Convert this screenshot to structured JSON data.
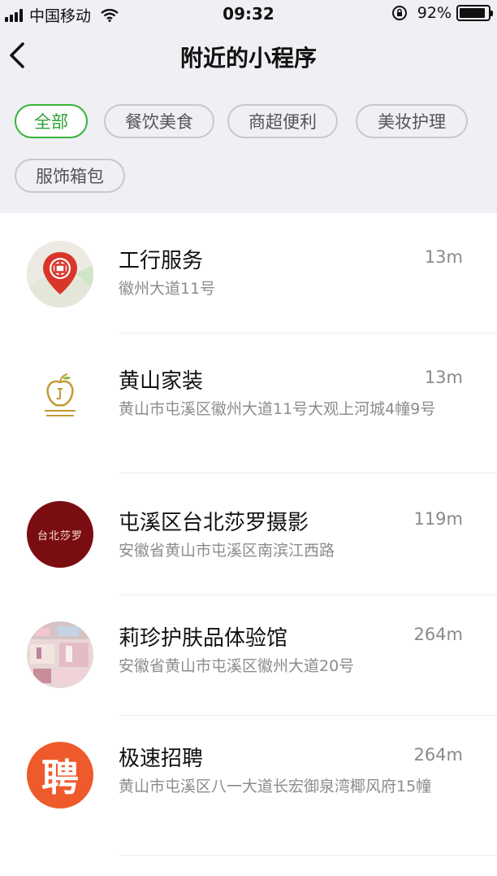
{
  "status_bar": {
    "carrier": "中国移动",
    "time": "09:32",
    "battery": "92%",
    "battery_level": 0.92
  },
  "nav": {
    "title": "附近的小程序",
    "back_icon": "chevron-left-icon"
  },
  "categories": [
    {
      "label": "全部",
      "active": true
    },
    {
      "label": "餐饮美食",
      "active": false
    },
    {
      "label": "商超便利",
      "active": false
    },
    {
      "label": "美妆护理",
      "active": false
    },
    {
      "label": "服饰箱包",
      "active": false
    }
  ],
  "items": [
    {
      "name": "工行服务",
      "distance": "13m",
      "address": "徽州大道11号",
      "icon": "icbc-map-pin-icon"
    },
    {
      "name": "黄山家装",
      "distance": "13m",
      "address": "黄山市屯溪区徽州大道11号大观上河城4幢9号",
      "icon": "golden-apple-logo"
    },
    {
      "name": "屯溪区台北莎罗摄影",
      "distance": "119m",
      "address": "安徽省黄山市屯溪区南滨江西路",
      "icon": "taipei-shaluo-logo",
      "logo_text": "台北莎罗"
    },
    {
      "name": "莉珍护肤品体验馆",
      "distance": "264m",
      "address": "安徽省黄山市屯溪区徽州大道20号",
      "icon": "store-photo-avatar"
    },
    {
      "name": "极速招聘",
      "distance": "264m",
      "address": "黄山市屯溪区八一大道长宏御泉湾椰风府15幢",
      "icon": "recruit-logo",
      "logo_text": "聘"
    }
  ],
  "colors": {
    "accent_green": "#36b23a",
    "header_bg": "#efeff4",
    "icbc_red": "#d9352a",
    "shaluo_red": "#7a0d12",
    "recruit_orange": "#ee5a2b"
  }
}
